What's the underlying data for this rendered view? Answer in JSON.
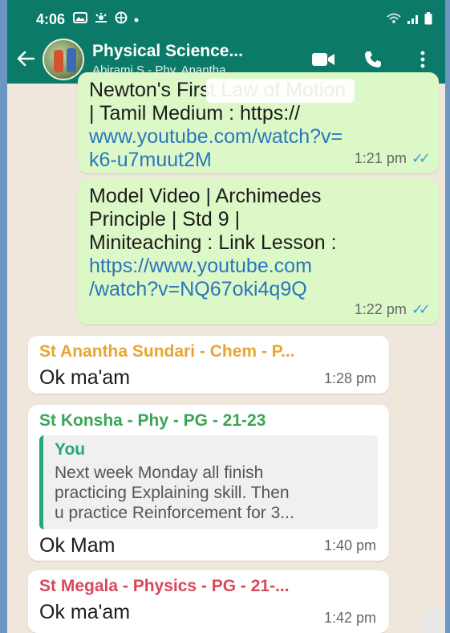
{
  "status": {
    "time": "4:06"
  },
  "header": {
    "title": "Physical Science...",
    "subtitle": "Abirami S - Phy, Anantha..."
  },
  "messages": [
    {
      "type": "outgoing",
      "text_line1": "Newton's First Law of Motion",
      "text_line2": "| Tamil Medium : https://",
      "link": "www.youtube.com/watch?v=k6-u7muut2M",
      "link_line1": "www.youtube.com/watch?v=",
      "link_line2": "k6-u7muut2M",
      "time": "1:21 pm"
    },
    {
      "type": "outgoing",
      "text_line1": "Model Video | Archimedes",
      "text_line2": "Principle | Std 9 |",
      "text_line3": "Miniteaching : Link Lesson :",
      "link_line1": "https://www.youtube.com",
      "link_line2": "/watch?v=NQ67oki4q9Q",
      "time": "1:22 pm"
    },
    {
      "type": "incoming",
      "sender": "St Anantha Sundari - Chem - P...",
      "sender_color": "#e8a530",
      "text": "Ok ma'am",
      "time": "1:28 pm"
    },
    {
      "type": "incoming",
      "sender": "St Konsha - Phy - PG - 21-23",
      "sender_color": "#3aa655",
      "quote_name": "You",
      "quote_line1": "Next week Monday all finish",
      "quote_line2": "practicing Explaining skill. Then",
      "quote_line3": "u practice Reinforcement for 3...",
      "text": "Ok Mam",
      "time": "1:40 pm"
    },
    {
      "type": "incoming",
      "sender": "St Megala - Physics - PG - 21-...",
      "sender_color": "#d9475b",
      "text": "Ok ma'am",
      "time": "1:42 pm"
    }
  ],
  "colors": {
    "header": "#0c7a68",
    "outgoing": "#dcf8c6",
    "incoming": "#ffffff",
    "link": "#2a76bd",
    "ticks": "#3d9be8"
  }
}
